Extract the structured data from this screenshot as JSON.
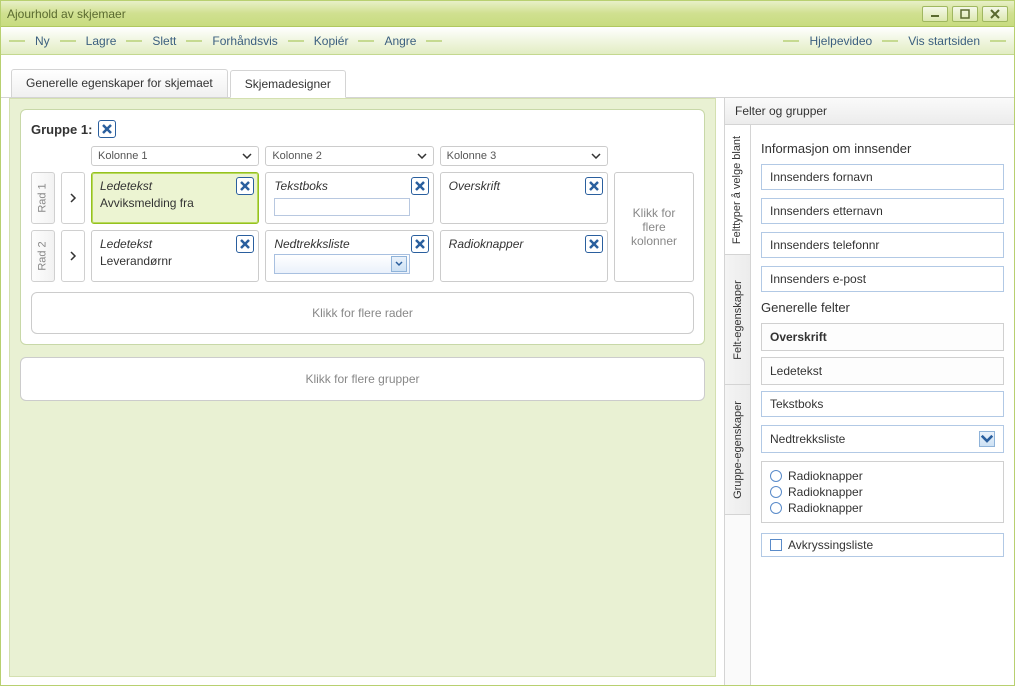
{
  "window": {
    "title": "Ajourhold av skjemaer"
  },
  "toolbar": {
    "items_left": [
      "Ny",
      "Lagre",
      "Slett",
      "Forhåndsvis",
      "Kopiér",
      "Angre"
    ],
    "items_right": [
      "Hjelpevideo",
      "Vis startsiden"
    ]
  },
  "tabs": {
    "general": "Generelle egenskaper for skjemaet",
    "designer": "Skjemadesigner"
  },
  "designer": {
    "group_label": "Gruppe 1:",
    "col_headers": [
      "Kolonne 1",
      "Kolonne 2",
      "Kolonne 3"
    ],
    "rows": [
      {
        "label": "Rad 1",
        "cells": [
          {
            "title": "Ledetekst",
            "sub": "Avviksmelding fra",
            "selected": true
          },
          {
            "title": "Tekstboks",
            "input": true
          },
          {
            "title": "Overskrift"
          }
        ]
      },
      {
        "label": "Rad 2",
        "cells": [
          {
            "title": "Ledetekst",
            "sub": "Leverandørnr"
          },
          {
            "title": "Nedtrekksliste",
            "select": true
          },
          {
            "title": "Radioknapper"
          }
        ]
      }
    ],
    "more_cols": "Klikk for flere kolonner",
    "more_rows": "Klikk for flere rader",
    "more_groups": "Klikk for flere grupper"
  },
  "right": {
    "title": "Felter og grupper",
    "vtabs": [
      "Felttyper å velge blant",
      "Felt-egenskaper",
      "Gruppe-egenskaper"
    ],
    "section1": "Informasjon om innsender",
    "sender_fields": [
      "Innsenders fornavn",
      "Innsenders etternavn",
      "Innsenders telefonnr",
      "Innsenders e-post"
    ],
    "section2": "Generelle felter",
    "generic": {
      "overskrift": "Overskrift",
      "ledetekst": "Ledetekst",
      "tekstboks": "Tekstboks",
      "nedtrekksliste": "Nedtrekksliste",
      "radioknapper": "Radioknapper",
      "avkryssingsliste": "Avkryssingsliste"
    }
  }
}
